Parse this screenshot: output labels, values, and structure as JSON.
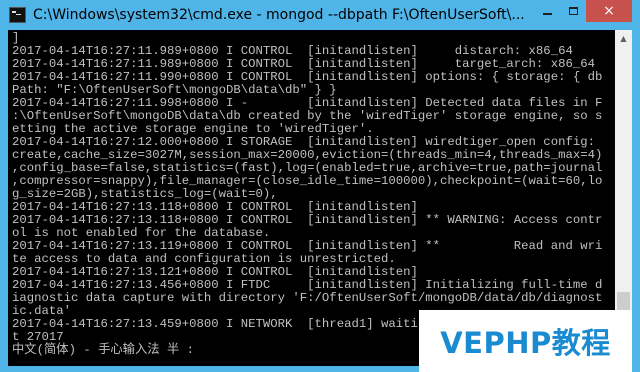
{
  "window": {
    "title": "C:\\Windows\\system32\\cmd.exe - mongod  --dbpath F:\\OftenUserSoft\\...",
    "icon": "cmd-icon",
    "buttons": {
      "minimize": "minimize-icon",
      "maximize": "maximize-icon",
      "close": "×"
    },
    "colors": {
      "titlebar": "#4fb4e8",
      "close": "#c7514c",
      "console_bg": "#000000",
      "console_fg": "#c0c0c0"
    }
  },
  "console": {
    "lines": [
      "]",
      "2017-04-14T16:27:11.989+0800 I CONTROL  [initandlisten]     distarch: x86_64",
      "2017-04-14T16:27:11.989+0800 I CONTROL  [initandlisten]     target_arch: x86_64",
      "2017-04-14T16:27:11.990+0800 I CONTROL  [initandlisten] options: { storage: { db",
      "Path: \"F:\\OftenUserSoft\\mongoDB\\data\\db\" } }",
      "2017-04-14T16:27:11.998+0800 I -        [initandlisten] Detected data files in F",
      ":\\OftenUserSoft\\mongoDB\\data\\db created by the 'wiredTiger' storage engine, so s",
      "etting the active storage engine to 'wiredTiger'.",
      "2017-04-14T16:27:12.000+0800 I STORAGE  [initandlisten] wiredtiger_open config:",
      "create,cache_size=3027M,session_max=20000,eviction=(threads_min=4,threads_max=4)",
      ",config_base=false,statistics=(fast),log=(enabled=true,archive=true,path=journal",
      ",compressor=snappy),file_manager=(close_idle_time=100000),checkpoint=(wait=60,lo",
      "g_size=2GB),statistics_log=(wait=0),",
      "2017-04-14T16:27:13.118+0800 I CONTROL  [initandlisten]",
      "2017-04-14T16:27:13.118+0800 I CONTROL  [initandlisten] ** WARNING: Access contr",
      "ol is not enabled for the database.",
      "2017-04-14T16:27:13.119+0800 I CONTROL  [initandlisten] **          Read and wri",
      "te access to data and configuration is unrestricted.",
      "2017-04-14T16:27:13.121+0800 I CONTROL  [initandlisten]",
      "2017-04-14T16:27:13.456+0800 I FTDC     [initandlisten] Initializing full-time d",
      "iagnostic data capture with directory 'F:/OftenUserSoft/mongoDB/data/db/diagnost",
      "ic.data'",
      "2017-04-14T16:27:13.459+0800 I NETWORK  [thread1] waiting for connections on por",
      "t 27017"
    ],
    "ime_status": "中文(简体) - 手心输入法 半 :"
  },
  "watermark": {
    "text": "VEPHP教程",
    "color": "#1a8bd0"
  }
}
